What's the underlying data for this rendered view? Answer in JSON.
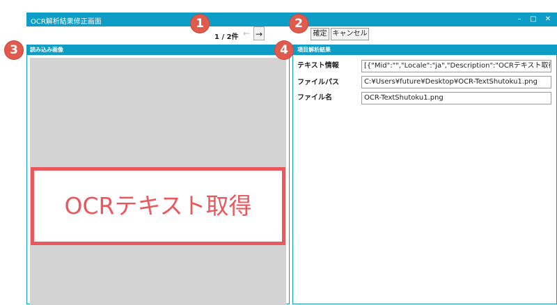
{
  "window": {
    "title": "OCR解析結果修正画面",
    "controls": {
      "minimize": "–",
      "maximize": "□",
      "close": "✕"
    }
  },
  "pager": {
    "text": "1 / 2件",
    "prev": "←",
    "next": "→"
  },
  "buttons": {
    "confirm": "確定",
    "cancel": "キャンセル"
  },
  "badges": [
    "1",
    "2",
    "3",
    "4"
  ],
  "left_panel": {
    "title": "読み込み画像",
    "image_text": "OCRテキスト取得"
  },
  "right_panel": {
    "title": "項目解析結果",
    "fields": [
      {
        "label": "テキスト情報",
        "value": "[{\"Mid\":\"\",\"Locale\":\"ja\",\"Description\":\"OCRテキスト取得¥n"
      },
      {
        "label": "ファイルパス",
        "value": "C:¥Users¥future¥Desktop¥OCR-TextShutoku1.png"
      },
      {
        "label": "ファイル名",
        "value": "OCR-TextShutoku1.png"
      }
    ]
  },
  "colors": {
    "accent": "#0e9dc6",
    "badge": "#e05a4e",
    "highlight": "#e8585c",
    "image_bg": "#d3d3d3"
  }
}
